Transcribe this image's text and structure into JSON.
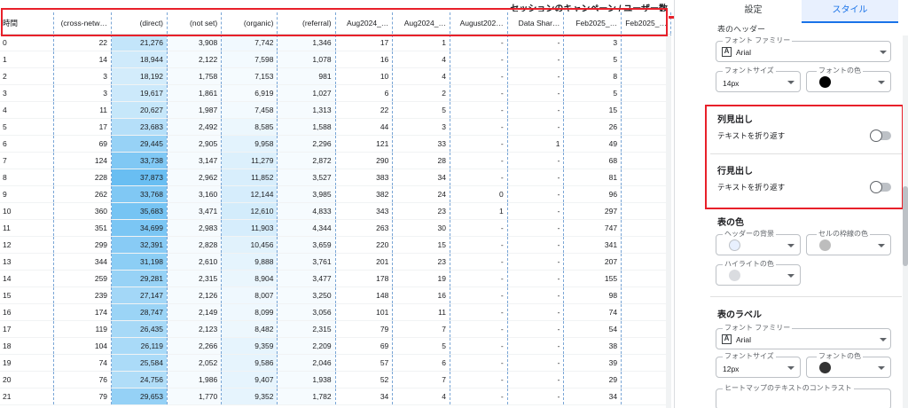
{
  "table": {
    "title": "セッションのキャンペーン / ユーザー数",
    "columns": [
      "時間",
      "(cross-netw…",
      "(direct)",
      "(not set)",
      "(organic)",
      "(referral)",
      "Aug2024_…",
      "Aug2024_…",
      "August202…",
      "Data Shar…",
      "Feb2025_…",
      "Feb2025_…"
    ],
    "rows": [
      [
        "0",
        "22",
        "21,276",
        "3,908",
        "7,742",
        "1,346",
        "17",
        "1",
        "-",
        "-",
        "3",
        ""
      ],
      [
        "1",
        "14",
        "18,944",
        "2,122",
        "7,598",
        "1,078",
        "16",
        "4",
        "-",
        "-",
        "5",
        ""
      ],
      [
        "2",
        "3",
        "18,192",
        "1,758",
        "7,153",
        "981",
        "10",
        "4",
        "-",
        "-",
        "8",
        ""
      ],
      [
        "3",
        "3",
        "19,617",
        "1,861",
        "6,919",
        "1,027",
        "6",
        "2",
        "-",
        "-",
        "5",
        ""
      ],
      [
        "4",
        "11",
        "20,627",
        "1,987",
        "7,458",
        "1,313",
        "22",
        "5",
        "-",
        "-",
        "15",
        ""
      ],
      [
        "5",
        "17",
        "23,683",
        "2,492",
        "8,585",
        "1,588",
        "44",
        "3",
        "-",
        "-",
        "26",
        ""
      ],
      [
        "6",
        "69",
        "29,445",
        "2,905",
        "9,958",
        "2,296",
        "121",
        "33",
        "-",
        "1",
        "49",
        ""
      ],
      [
        "7",
        "124",
        "33,738",
        "3,147",
        "11,279",
        "2,872",
        "290",
        "28",
        "-",
        "-",
        "68",
        ""
      ],
      [
        "8",
        "228",
        "37,873",
        "2,962",
        "11,852",
        "3,527",
        "383",
        "34",
        "-",
        "-",
        "81",
        ""
      ],
      [
        "9",
        "262",
        "33,768",
        "3,160",
        "12,144",
        "3,985",
        "382",
        "24",
        "0",
        "-",
        "96",
        ""
      ],
      [
        "10",
        "360",
        "35,683",
        "3,471",
        "12,610",
        "4,833",
        "343",
        "23",
        "1",
        "-",
        "297",
        ""
      ],
      [
        "11",
        "351",
        "34,699",
        "2,983",
        "11,903",
        "4,344",
        "263",
        "30",
        "-",
        "-",
        "747",
        ""
      ],
      [
        "12",
        "299",
        "32,391",
        "2,828",
        "10,456",
        "3,659",
        "220",
        "15",
        "-",
        "-",
        "341",
        ""
      ],
      [
        "13",
        "344",
        "31,198",
        "2,610",
        "9,888",
        "3,761",
        "201",
        "23",
        "-",
        "-",
        "207",
        ""
      ],
      [
        "14",
        "259",
        "29,281",
        "2,315",
        "8,904",
        "3,477",
        "178",
        "19",
        "-",
        "-",
        "155",
        ""
      ],
      [
        "15",
        "239",
        "27,147",
        "2,126",
        "8,007",
        "3,250",
        "148",
        "16",
        "-",
        "-",
        "98",
        ""
      ],
      [
        "16",
        "174",
        "28,747",
        "2,149",
        "8,099",
        "3,056",
        "101",
        "11",
        "-",
        "-",
        "74",
        ""
      ],
      [
        "17",
        "119",
        "26,435",
        "2,123",
        "8,482",
        "2,315",
        "79",
        "7",
        "-",
        "-",
        "54",
        ""
      ],
      [
        "18",
        "104",
        "26,119",
        "2,266",
        "9,359",
        "2,209",
        "69",
        "5",
        "-",
        "-",
        "38",
        ""
      ],
      [
        "19",
        "74",
        "25,584",
        "2,052",
        "9,586",
        "2,046",
        "57",
        "6",
        "-",
        "-",
        "39",
        ""
      ],
      [
        "20",
        "76",
        "24,756",
        "1,986",
        "9,407",
        "1,938",
        "52",
        "7",
        "-",
        "-",
        "29",
        ""
      ],
      [
        "21",
        "79",
        "29,653",
        "1,770",
        "9,352",
        "1,782",
        "34",
        "4",
        "-",
        "-",
        "34",
        ""
      ]
    ],
    "heat_color": "#4fb3f0"
  },
  "panel": {
    "tabs": [
      "設定",
      "スタイル"
    ],
    "header_section_label": "表のヘッダー",
    "header_font_family_label": "フォント ファミリー",
    "header_font_family_value": "Arial",
    "header_font_size_label": "フォントサイズ",
    "header_font_size_value": "14px",
    "header_font_color_label": "フォントの色",
    "column_header_title": "列見出し",
    "column_header_wrap_label": "テキストを折り返す",
    "row_header_title": "行見出し",
    "row_header_wrap_label": "テキストを折り返す",
    "table_colors_title": "表の色",
    "header_bg_label": "ヘッダーの背景",
    "cell_border_label": "セルの枠線の色",
    "highlight_label": "ハイライトの色",
    "table_labels_title": "表のラベル",
    "label_font_family_label": "フォント ファミリー",
    "label_font_family_value": "Arial",
    "label_font_size_label": "フォントサイズ",
    "label_font_size_value": "12px",
    "label_font_color_label": "フォントの色",
    "heatmap_contrast_label": "ヒートマップのテキストのコントラスト",
    "colors": {
      "accent": "#1a73e8",
      "highlight_red": "#e8202a",
      "header_font_color": "#000000",
      "header_bg": "#e8f0fe",
      "cell_border": "#bdbdbd",
      "highlight": "#dadce0",
      "label_font_color": "#333333"
    }
  }
}
